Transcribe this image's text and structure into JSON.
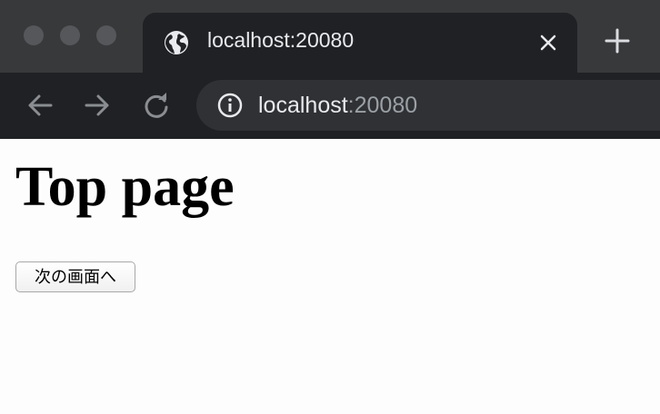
{
  "browser": {
    "tab": {
      "title": "localhost:20080",
      "icon": "globe-icon",
      "close_icon": "close-icon"
    },
    "new_tab_icon": "plus-icon",
    "nav": {
      "back_icon": "arrow-left-icon",
      "forward_icon": "arrow-right-icon",
      "reload_icon": "reload-icon"
    },
    "address_bar": {
      "info_icon": "info-icon",
      "host": "localhost",
      "port": ":20080"
    }
  },
  "page": {
    "heading": "Top page",
    "next_button_label": "次の画面へ"
  },
  "colors": {
    "tabstrip": "#38393b",
    "toolbar": "#202124",
    "omnibox": "#303134",
    "page_background": "#fdfdfd"
  }
}
